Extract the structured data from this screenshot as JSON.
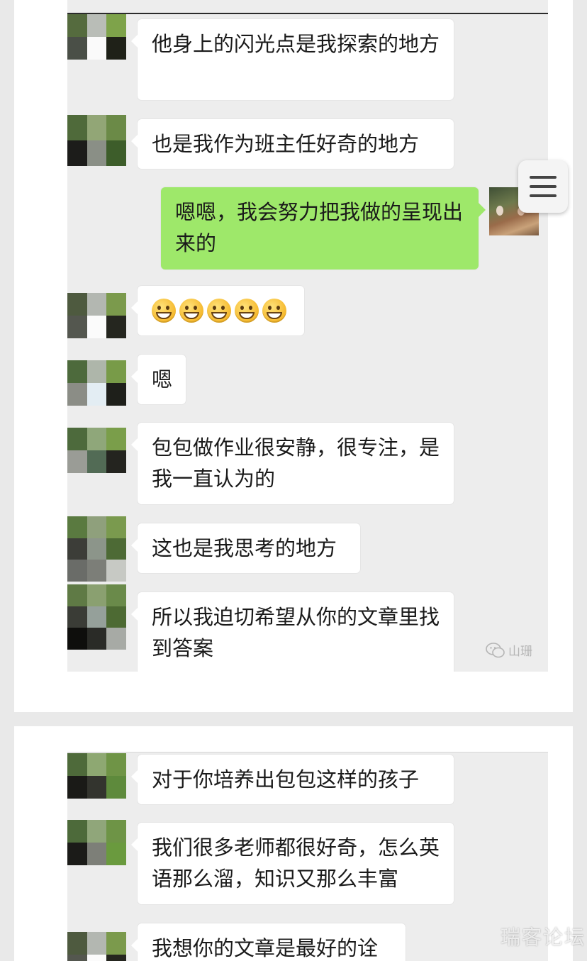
{
  "colors": {
    "page_bg": "#e9e9e9",
    "chat_bg": "#ededed",
    "bubble_white": "#ffffff",
    "bubble_green": "#9ee86a"
  },
  "screenshot_1": {
    "messages": [
      {
        "side": "left",
        "text": "他身上的闪光点是我探索的地方"
      },
      {
        "side": "left",
        "text": "也是我作为班主任好奇的地方"
      },
      {
        "side": "right",
        "text": "嗯嗯，我会努力把我做的呈现出来的"
      },
      {
        "side": "left",
        "type": "emoji",
        "emoji": "grinning-face-emoji",
        "count": 5
      },
      {
        "side": "left",
        "text": "嗯"
      },
      {
        "side": "left",
        "text": "包包做作业很安静，很专注，是我一直认为的"
      },
      {
        "side": "left",
        "text": "这也是我思考的地方"
      },
      {
        "side": "left",
        "text": "所以我迫切希望从你的文章里找到答案"
      }
    ],
    "watermark": "山珊"
  },
  "screenshot_2": {
    "messages": [
      {
        "side": "left",
        "text": "对于你培养出包包这样的孩子"
      },
      {
        "side": "left",
        "text": "我们很多老师都很好奇，怎么英语那么溜，知识又那么丰富"
      },
      {
        "side": "left",
        "text": "我想你的文章是最好的诠释"
      }
    ]
  },
  "floating_menu": {
    "icon": "hamburger-menu-icon"
  },
  "site_watermark": "瑞客论坛"
}
